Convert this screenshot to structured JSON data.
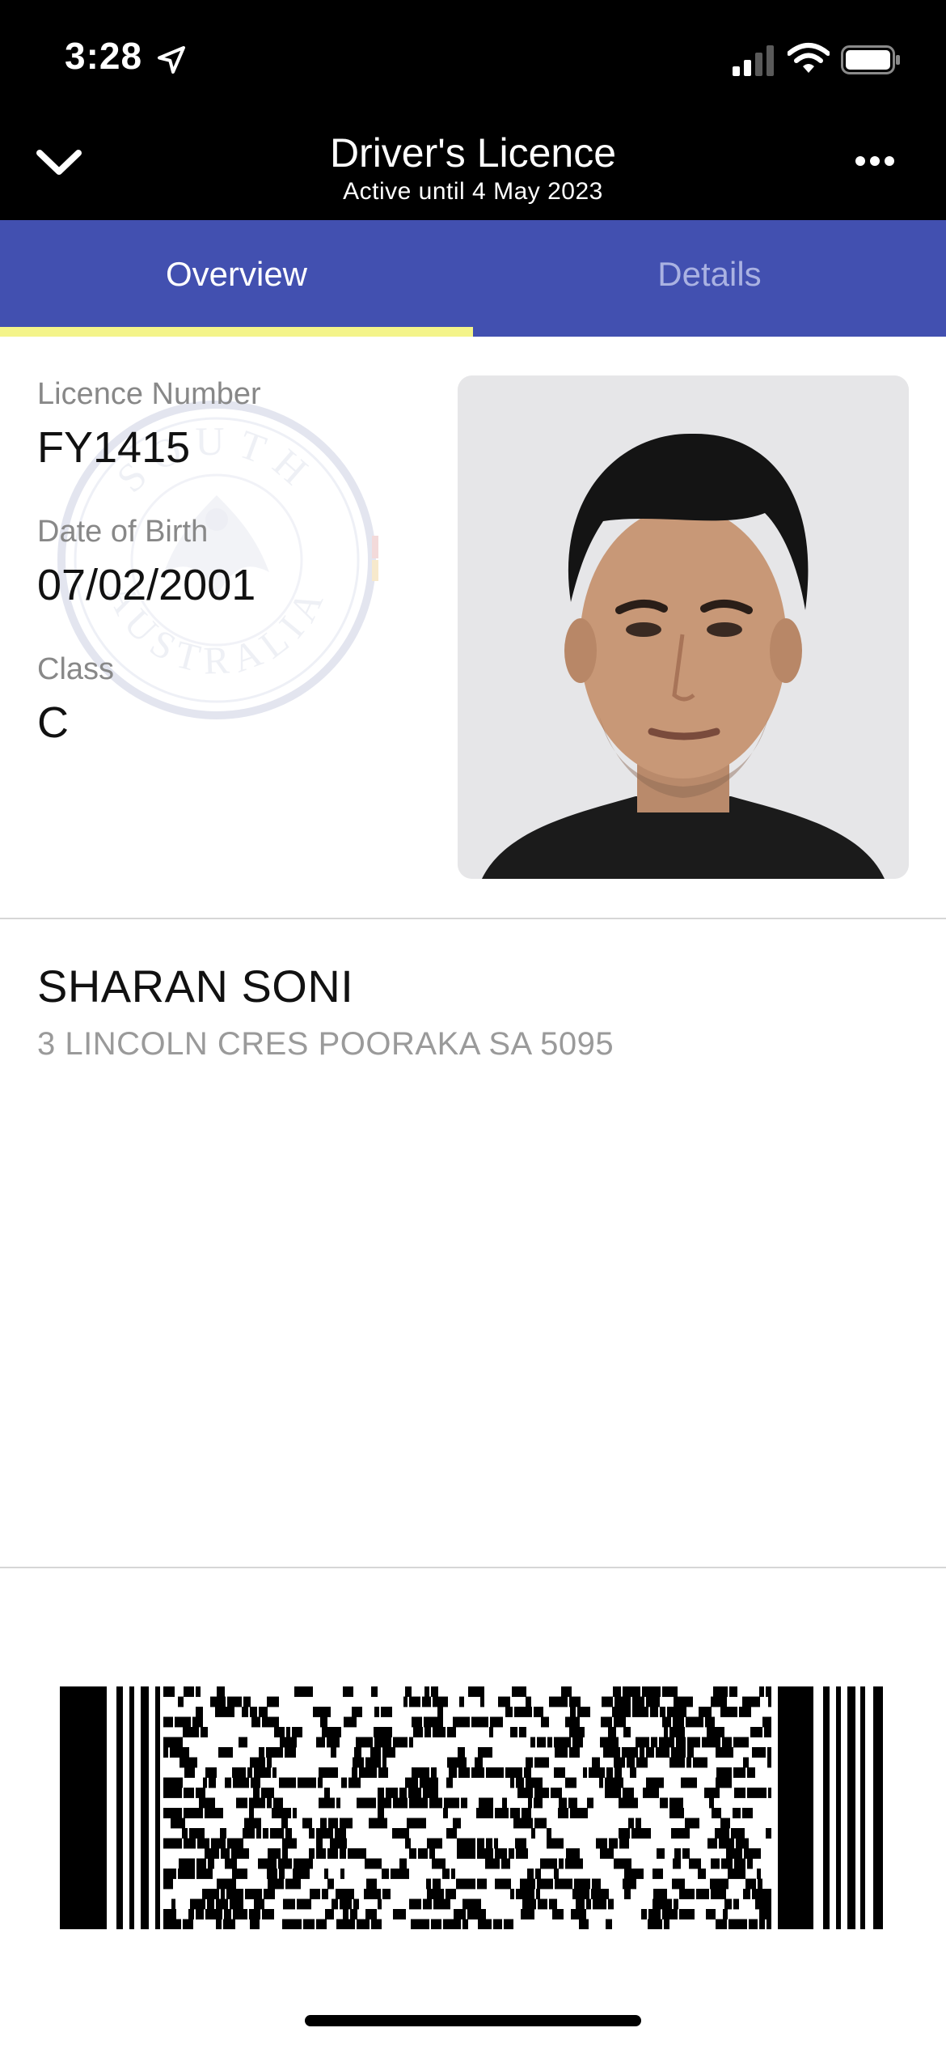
{
  "status_bar": {
    "time": "3:28",
    "icons": [
      "location-arrow-icon",
      "cellular-signal-icon",
      "wifi-icon",
      "battery-icon"
    ]
  },
  "header": {
    "title": "Driver's Licence",
    "subtitle": "Active until 4 May 2023",
    "back_icon": "chevron-down-icon",
    "more_icon": "more-horizontal-icon"
  },
  "tabs": [
    {
      "label": "Overview",
      "active": true
    },
    {
      "label": "Details",
      "active": false
    }
  ],
  "colors": {
    "tab_bar": "#4250b0",
    "active_indicator": "#f4f48a",
    "header_bg": "#000000"
  },
  "licence": {
    "number_label": "Licence Number",
    "number": "FY1415",
    "dob_label": "Date of Birth",
    "dob": "07/02/2001",
    "class_label": "Class",
    "class": "C"
  },
  "seal": {
    "text": "SOUTH AUSTRALIA"
  },
  "holder": {
    "name": "SHARAN SONI",
    "address": "3 LINCOLN CRES POORAKA SA 5095"
  },
  "barcode": {
    "type": "PDF417"
  }
}
